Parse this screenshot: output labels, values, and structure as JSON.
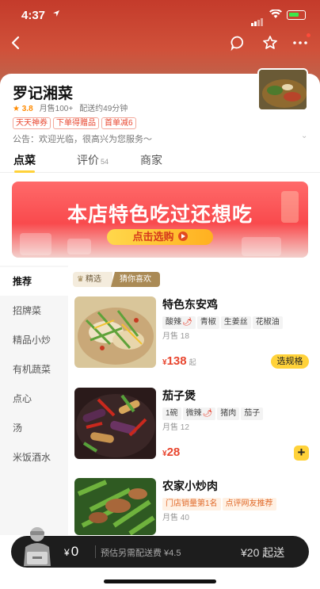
{
  "status_bar": {
    "time": "4:37"
  },
  "shop": {
    "name": "罗记湘菜",
    "rating": "3.8",
    "monthly_sales": "月售100+",
    "delivery_time": "配送约49分钟",
    "promos": [
      "天天神券",
      "下单得赠品",
      "首单减6"
    ],
    "notice": "公告：欢迎光临，很高兴为您服务～"
  },
  "tabs": [
    {
      "label": "点菜",
      "count": ""
    },
    {
      "label": "评价",
      "count": "54"
    },
    {
      "label": "商家",
      "count": ""
    }
  ],
  "banner": {
    "title": "本店特色吃过还想吃",
    "button": "点击选购"
  },
  "sidebar": {
    "items": [
      {
        "label": "推荐"
      },
      {
        "label": "招牌菜"
      },
      {
        "label": "精品小炒"
      },
      {
        "label": "有机蔬菜"
      },
      {
        "label": "点心"
      },
      {
        "label": "汤"
      },
      {
        "label": "米饭酒水"
      }
    ]
  },
  "section_chips": {
    "featured": "精选",
    "guess": "猜你喜欢"
  },
  "dishes": [
    {
      "name": "特色东安鸡",
      "attrs": [
        {
          "text": "酸辣",
          "chili": true
        },
        {
          "text": "青椒",
          "chili": false
        },
        {
          "text": "生姜丝",
          "chili": false
        },
        {
          "text": "花椒油",
          "chili": false
        }
      ],
      "sold": "月售 18",
      "currency": "¥",
      "price": "138",
      "price_suffix": "起",
      "action": "选规格"
    },
    {
      "name": "茄子煲",
      "attrs": [
        {
          "text": "1碗",
          "chili": false
        },
        {
          "text": "微辣",
          "chili": true
        },
        {
          "text": "猪肉",
          "chili": false
        },
        {
          "text": "茄子",
          "chili": false
        }
      ],
      "sold": "月售 12",
      "currency": "¥",
      "price": "28",
      "price_suffix": "",
      "action": "+"
    },
    {
      "name": "农家小炒肉",
      "attrs": [
        {
          "text": "门店销量第1名",
          "promo": true
        },
        {
          "text": "点评网友推荐",
          "promo": true
        }
      ],
      "sold": "月售 40"
    }
  ],
  "cart": {
    "currency": "¥",
    "amount": "0",
    "delivery_fee_note": "预估另需配送费 ¥4.5",
    "min_order": "¥20 起送"
  },
  "colors": {
    "accent": "#ffd23a",
    "price": "#e8462f",
    "header": "#c43b2b"
  }
}
